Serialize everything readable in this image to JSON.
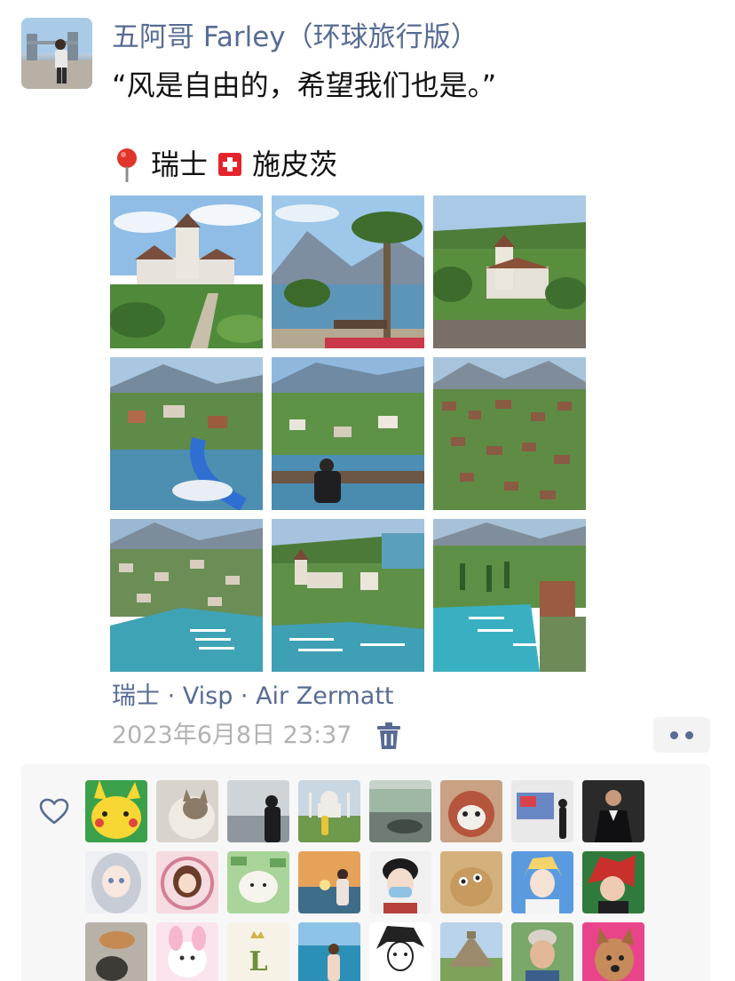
{
  "post": {
    "author_name": "五阿哥 Farley（环球旅行版）",
    "text": "“风是自由的，希望我们也是。”",
    "location_country": "瑞士",
    "location_town": "施皮茨",
    "place_link": "瑞士 · Visp · Air Zermatt",
    "timestamp": "2023年6月8日 23:37"
  },
  "icons": {
    "pin": "map-pin-icon",
    "flag": "swiss-flag-icon",
    "trash": "trash-icon",
    "more": "more-dots-icon",
    "heart": "heart-icon"
  },
  "colors": {
    "link": "#576b95",
    "timestamp": "#b2b2b2",
    "panel_background": "#f7f7f7",
    "flag_red": "#e3242b"
  },
  "photos": [
    {
      "name": "photo-castle-garden"
    },
    {
      "name": "photo-palm-lakeside"
    },
    {
      "name": "photo-castle-aerial"
    },
    {
      "name": "photo-village-waterslide"
    },
    {
      "name": "photo-person-on-bench"
    },
    {
      "name": "photo-village-aerial"
    },
    {
      "name": "photo-harbor-aerial-1"
    },
    {
      "name": "photo-castle-harbor"
    },
    {
      "name": "photo-harbor-aerial-2"
    }
  ],
  "like_avatars": [
    {
      "name": "liker-avatar-pikachu"
    },
    {
      "name": "liker-avatar-cat"
    },
    {
      "name": "liker-avatar-silhouette"
    },
    {
      "name": "liker-avatar-taj-mahal"
    },
    {
      "name": "liker-avatar-car-window"
    },
    {
      "name": "liker-avatar-plush-cat"
    },
    {
      "name": "liker-avatar-gallery"
    },
    {
      "name": "liker-avatar-suit"
    },
    {
      "name": "liker-avatar-anime-girl"
    },
    {
      "name": "liker-avatar-cartoon-girl"
    },
    {
      "name": "liker-avatar-money-cat"
    },
    {
      "name": "liker-avatar-sunset"
    },
    {
      "name": "liker-avatar-masked-boy"
    },
    {
      "name": "liker-avatar-bear-toy"
    },
    {
      "name": "liker-avatar-anime-blond"
    },
    {
      "name": "liker-avatar-anime-red"
    },
    {
      "name": "liker-avatar-cat-shadow"
    },
    {
      "name": "liker-avatar-pink-bunny"
    },
    {
      "name": "liker-avatar-letter"
    },
    {
      "name": "liker-avatar-sea-girl"
    },
    {
      "name": "liker-avatar-manga"
    },
    {
      "name": "liker-avatar-pyramid"
    },
    {
      "name": "liker-avatar-smiling-man"
    },
    {
      "name": "liker-avatar-dog"
    }
  ]
}
